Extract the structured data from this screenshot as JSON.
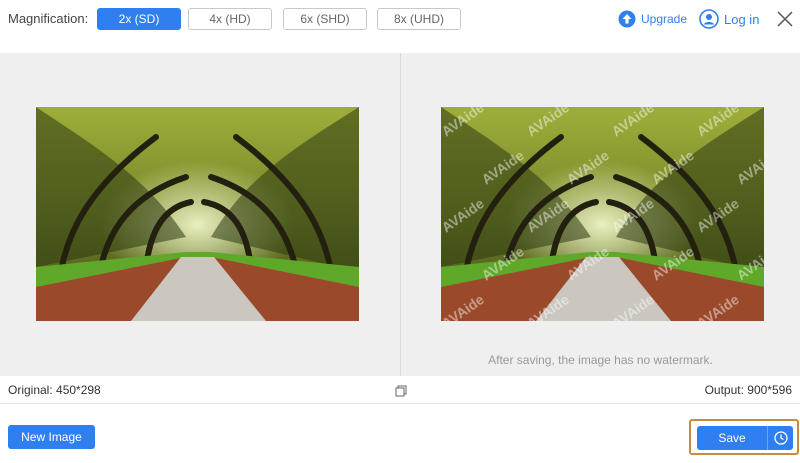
{
  "topbar": {
    "magnification_label": "Magnification:",
    "options": [
      "2x (SD)",
      "4x (HD)",
      "6x (SHD)",
      "8x (UHD)"
    ],
    "selected": "2x (SD)",
    "upgrade_label": "Upgrade",
    "login_label": "Log in"
  },
  "preview": {
    "watermark_note": "After saving, the image has no watermark.",
    "watermark_text": "AVAide"
  },
  "info": {
    "original": "Original: 450*298",
    "output": "Output: 900*596"
  },
  "footer": {
    "new_image_label": "New Image",
    "save_label": "Save"
  },
  "colors": {
    "accent": "#2f7ff0",
    "highlight_border": "#c98c3f",
    "preview_bg": "#efefef"
  },
  "icons": [
    "upgrade-arrow-icon",
    "user-icon",
    "close-icon",
    "compare-icon",
    "clock-icon"
  ]
}
